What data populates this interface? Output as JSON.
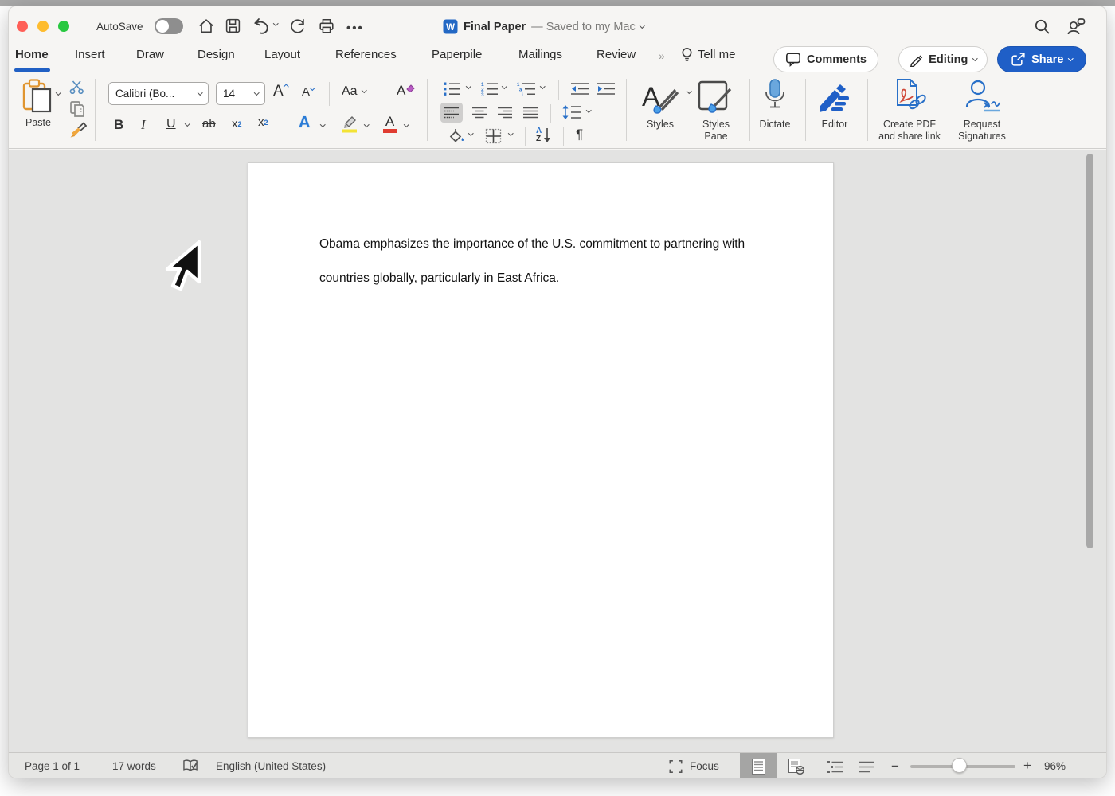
{
  "titlebar": {
    "autosave": "AutoSave",
    "title": "Final Paper",
    "status": "— Saved to my Mac",
    "ellipsis": "•••"
  },
  "tabs": {
    "items": [
      {
        "label": "Home"
      },
      {
        "label": "Insert"
      },
      {
        "label": "Draw"
      },
      {
        "label": "Design"
      },
      {
        "label": "Layout"
      },
      {
        "label": "References"
      },
      {
        "label": "Paperpile"
      },
      {
        "label": "Mailings"
      },
      {
        "label": "Review"
      }
    ],
    "overflow": "»",
    "tell_me": "Tell me"
  },
  "topbuttons": {
    "comments": "Comments",
    "editing": "Editing",
    "share": "Share"
  },
  "ribbon": {
    "paste": "Paste",
    "font_name": "Calibri (Bo...",
    "font_size": "14",
    "grow": "A",
    "shrink": "A",
    "case_label": "Aa",
    "clear_label": "A",
    "bold": "B",
    "italic": "I",
    "underline": "U",
    "strike": "ab",
    "sub_base": "x",
    "sub_mark": "2",
    "sup_base": "x",
    "sup_mark": "2",
    "effects": "A",
    "fontcolor": "A",
    "sort_a": "A",
    "sort_z": "Z",
    "pilcrow": "¶",
    "styles": "Styles",
    "styles_pane_1": "Styles",
    "styles_pane_2": "Pane",
    "dictate": "Dictate",
    "editor": "Editor",
    "create_pdf_1": "Create PDF",
    "create_pdf_2": "and share link",
    "request_1": "Request",
    "request_2": "Signatures"
  },
  "document": {
    "line1": "Obama emphasizes the importance of the U.S. commitment to partnering with",
    "line2": "countries globally, particularly in East Africa."
  },
  "statusbar": {
    "page": "Page 1 of 1",
    "words": "17 words",
    "language": "English (United States)",
    "focus": "Focus",
    "minus": "−",
    "plus": "+",
    "zoom": "96%"
  }
}
